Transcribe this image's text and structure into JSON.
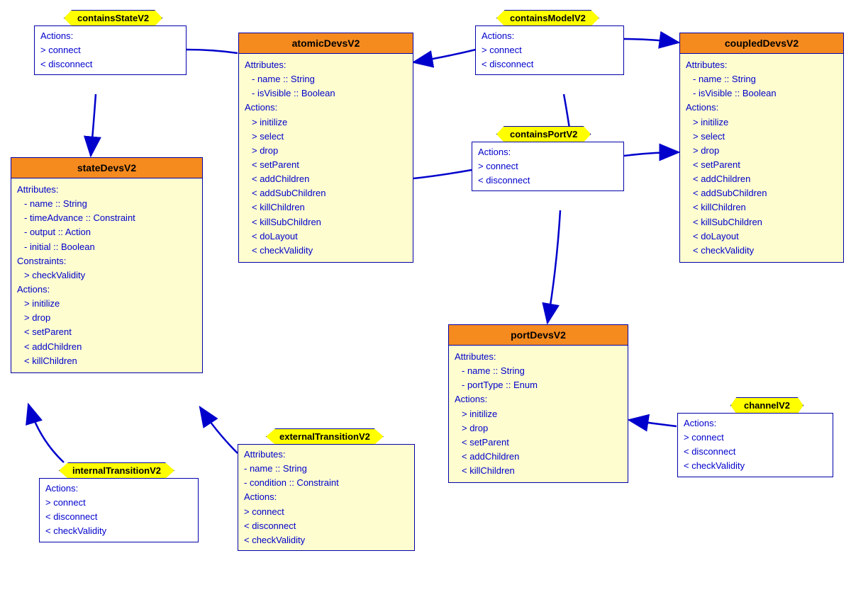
{
  "containsStateV2": {
    "title": "containsStateV2",
    "sec1": "Actions:",
    "a1": "> connect",
    "a2": "< disconnect"
  },
  "atomicDevsV2": {
    "title": "atomicDevsV2",
    "sec1": "Attributes:",
    "p1": "- name :: String",
    "p2": "- isVisible :: Boolean",
    "sec2": "Actions:",
    "a1": "> initilize",
    "a2": "> select",
    "a3": "> drop",
    "a4": "< setParent",
    "a5": "< addChildren",
    "a6": "< addSubChildren",
    "a7": "< killChildren",
    "a8": "< killSubChildren",
    "a9": "< doLayout",
    "a10": "< checkValidity"
  },
  "containsModelV2": {
    "title": "containsModelV2",
    "sec1": "Actions:",
    "a1": "> connect",
    "a2": "< disconnect"
  },
  "coupledDevsV2": {
    "title": "coupledDevsV2",
    "sec1": "Attributes:",
    "p1": "- name :: String",
    "p2": "- isVisible :: Boolean",
    "sec2": "Actions:",
    "a1": "> initilize",
    "a2": "> select",
    "a3": "> drop",
    "a4": "< setParent",
    "a5": "< addChildren",
    "a6": "< addSubChildren",
    "a7": "< killChildren",
    "a8": "< killSubChildren",
    "a9": "< doLayout",
    "a10": "< checkValidity"
  },
  "containsPortV2": {
    "title": "containsPortV2",
    "sec1": "Actions:",
    "a1": "> connect",
    "a2": "< disconnect"
  },
  "stateDevsV2": {
    "title": "stateDevsV2",
    "sec1": "Attributes:",
    "p1": "- name :: String",
    "p2": "- timeAdvance :: Constraint",
    "p3": "- output :: Action",
    "p4": "- initial :: Boolean",
    "sec2": "Constraints:",
    "c1": "> checkValidity",
    "sec3": "Actions:",
    "a1": "> initilize",
    "a2": "> drop",
    "a3": "< setParent",
    "a4": "< addChildren",
    "a5": "< killChildren"
  },
  "portDevsV2": {
    "title": "portDevsV2",
    "sec1": "Attributes:",
    "p1": "- name :: String",
    "p2": "- portType :: Enum",
    "sec2": "Actions:",
    "a1": "> initilize",
    "a2": "> drop",
    "a3": "< setParent",
    "a4": "< addChildren",
    "a5": "< killChildren"
  },
  "channelV2": {
    "title": "channelV2",
    "sec1": "Actions:",
    "a1": "> connect",
    "a2": "< disconnect",
    "a3": "< checkValidity"
  },
  "internalTransitionV2": {
    "title": "internalTransitionV2",
    "sec1": "Actions:",
    "a1": "> connect",
    "a2": "< disconnect",
    "a3": "< checkValidity"
  },
  "externalTransitionV2": {
    "title": "externalTransitionV2",
    "sec1": "Attributes:",
    "p1": "- name :: String",
    "p2": "- condition :: Constraint",
    "sec2": "Actions:",
    "a1": "> connect",
    "a2": "< disconnect",
    "a3": "< checkValidity"
  }
}
